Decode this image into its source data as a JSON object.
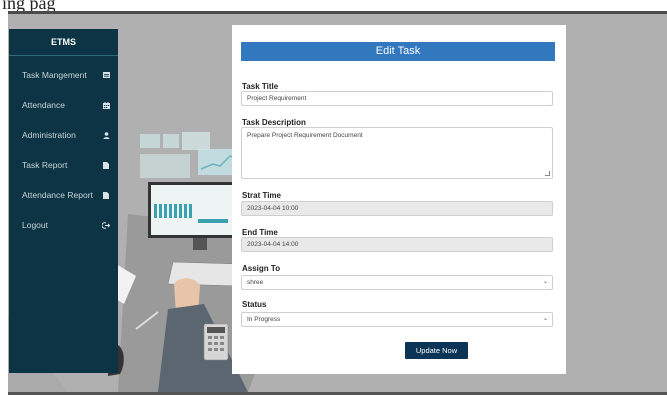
{
  "sidebar": {
    "brand": "ETMS",
    "items": [
      {
        "label": "Task Mangement",
        "icon": "calendar-icon"
      },
      {
        "label": "Attendance",
        "icon": "calendar-grid-icon"
      },
      {
        "label": "Administration",
        "icon": "user-icon"
      },
      {
        "label": "Task Report",
        "icon": "file-icon"
      },
      {
        "label": "Attendance Report",
        "icon": "file-icon"
      },
      {
        "label": "Logout",
        "icon": "logout-icon"
      }
    ]
  },
  "form": {
    "title": "Edit Task",
    "task_title_label": "Task Title",
    "task_title_value": "Project Requirement",
    "description_label": "Task Description",
    "description_value": "Prepare Project Requirement Document",
    "start_label": "Strat Time",
    "start_value": "2023-04-04 10:00",
    "end_label": "End Time",
    "end_value": "2023-04-04 14:00",
    "assign_label": "Assign To",
    "assign_value": "shree",
    "status_label": "Status",
    "status_value": "In Progress",
    "submit_label": "Update Now"
  },
  "colors": {
    "sidebar_bg": "#0c3444",
    "header_bg": "#3278be",
    "button_bg": "#0c3456",
    "page_bg": "#a9a9a9"
  },
  "top_text": "ing pag"
}
